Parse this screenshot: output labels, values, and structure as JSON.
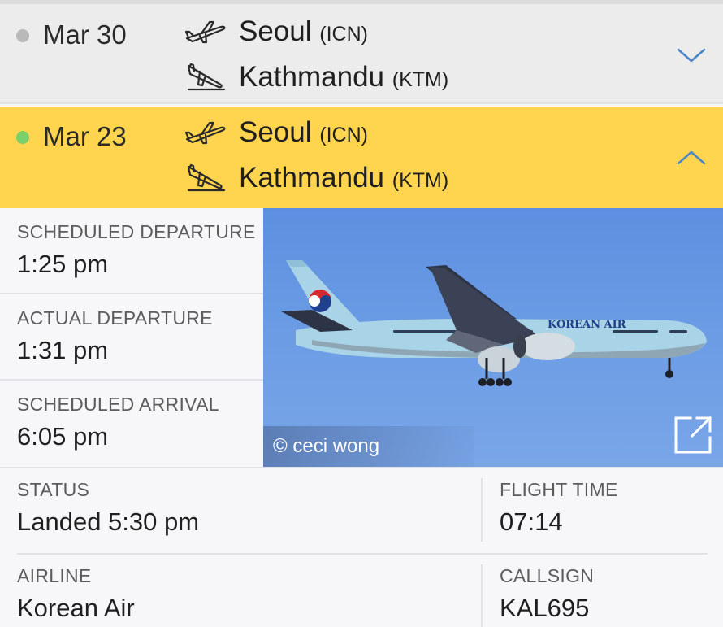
{
  "flights": [
    {
      "date": "Mar 30",
      "origin": {
        "city": "Seoul",
        "code": "(ICN)"
      },
      "destination": {
        "city": "Kathmandu",
        "code": "(KTM)"
      },
      "expanded": false
    },
    {
      "date": "Mar 23",
      "origin": {
        "city": "Seoul",
        "code": "(ICN)"
      },
      "destination": {
        "city": "Kathmandu",
        "code": "(KTM)"
      },
      "expanded": true
    }
  ],
  "details": {
    "scheduled_departure": {
      "label": "SCHEDULED DEPARTURE",
      "value": "1:25 pm"
    },
    "actual_departure": {
      "label": "ACTUAL DEPARTURE",
      "value": "1:31 pm"
    },
    "scheduled_arrival": {
      "label": "SCHEDULED ARRIVAL",
      "value": "6:05 pm"
    },
    "status": {
      "label": "STATUS",
      "value": "Landed 5:30 pm"
    },
    "flight_time": {
      "label": "FLIGHT TIME",
      "value": "07:14"
    },
    "airline": {
      "label": "AIRLINE",
      "value": "Korean Air"
    },
    "callsign": {
      "label": "CALLSIGN",
      "value": "KAL695"
    }
  },
  "photo": {
    "credit": "© ceci wong",
    "livery_text": "KOREAN AIR"
  },
  "colors": {
    "selected_row": "#ffd54f",
    "collapsed_row": "#ececec",
    "active_dot": "#7bd06a",
    "inactive_dot": "#b9b9b9",
    "chevron": "#4a86c8"
  }
}
